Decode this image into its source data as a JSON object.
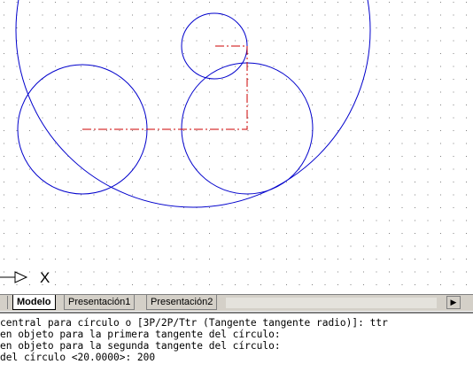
{
  "tabs": [
    {
      "label": "Modelo"
    },
    {
      "label": "Presentación1"
    },
    {
      "label": "Presentación2"
    }
  ],
  "ucs_label": "X",
  "command_lines": [
    "central para círculo o [3P/2P/Ttr (Tangente tangente radio)]: ttr",
    "en objeto para la primera tangente del círculo:",
    "en objeto para la segunda tangente del círculo:",
    "del círculo <20.0000>: 200"
  ],
  "colors": {
    "circle": "#0000cc",
    "dimension_line": "#cc0000",
    "grid_dot": "#808080",
    "tab_bar": "#d4d0c8"
  }
}
